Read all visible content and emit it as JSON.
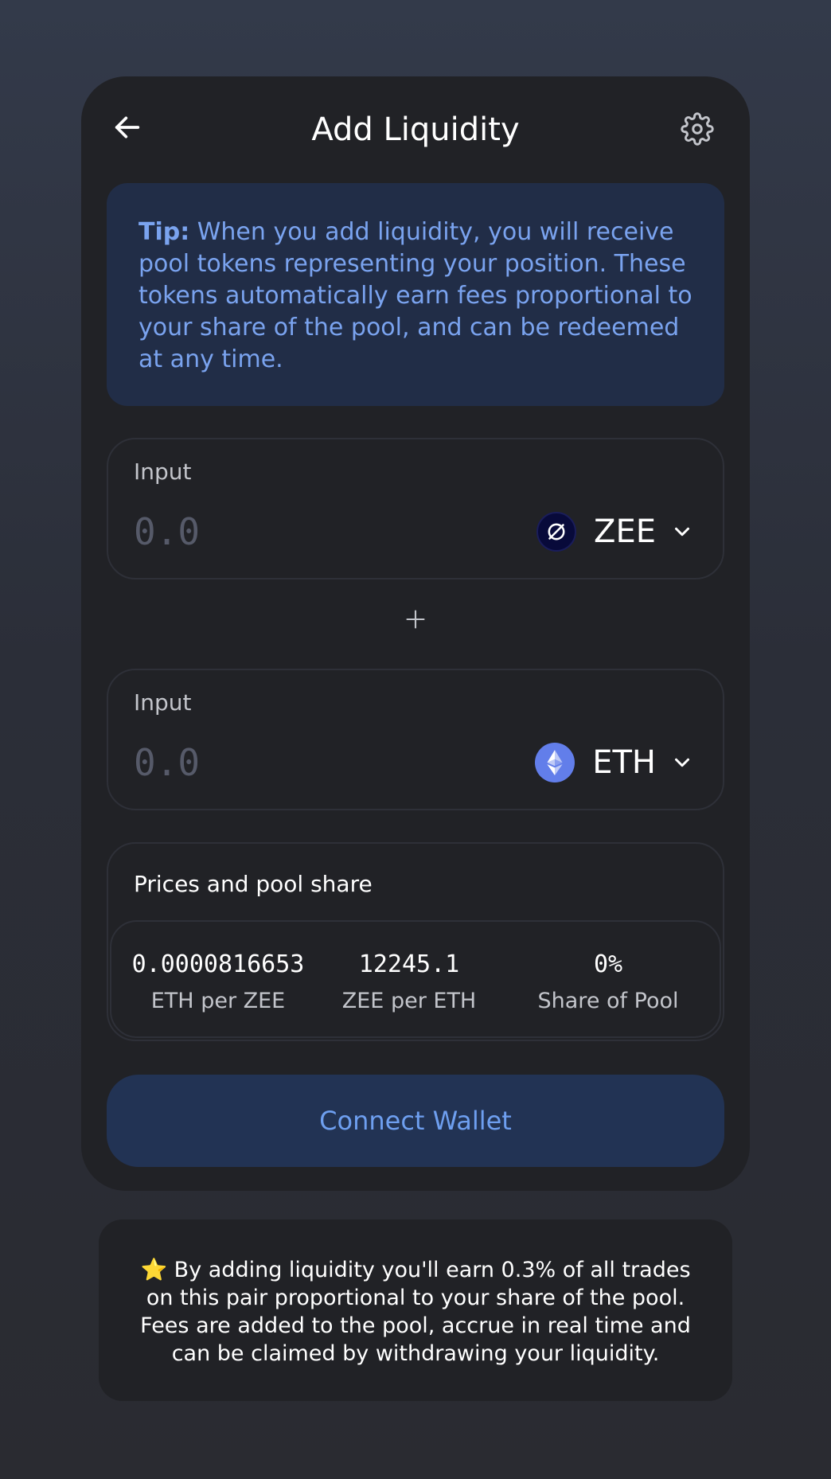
{
  "header": {
    "title": "Add Liquidity",
    "back_icon": "arrow-left-icon",
    "settings_icon": "gear-icon"
  },
  "tip": {
    "label": "Tip:",
    "text": " When you add liquidity, you will receive pool tokens representing your position. These tokens automatically earn fees proportional to your share of the pool, and can be redeemed at any time."
  },
  "inputs": [
    {
      "label": "Input",
      "placeholder": "0.0",
      "value": "",
      "token": "ZEE",
      "token_icon": "zee-token-icon"
    },
    {
      "label": "Input",
      "placeholder": "0.0",
      "value": "",
      "token": "ETH",
      "token_icon": "eth-token-icon"
    }
  ],
  "plus_icon": "plus-icon",
  "prices": {
    "title": "Prices and pool share",
    "stats": [
      {
        "value": "0.0000816653",
        "label": "ETH per ZEE"
      },
      {
        "value": "12245.1",
        "label": "ZEE per ETH"
      },
      {
        "value": "0%",
        "label": "Share of Pool"
      }
    ]
  },
  "connect_button": "Connect Wallet",
  "info": {
    "star": "⭐",
    "text": " By adding liquidity you'll earn 0.3% of all trades on this pair proportional to your share of the pool. Fees are added to the pool, accrue in real time and can be claimed by withdrawing your liquidity."
  },
  "colors": {
    "card": "#212226",
    "tip_bg": "#212d47",
    "tip_text": "#7aa3ef",
    "button_bg": "#223354",
    "button_text": "#6e9ff0"
  }
}
